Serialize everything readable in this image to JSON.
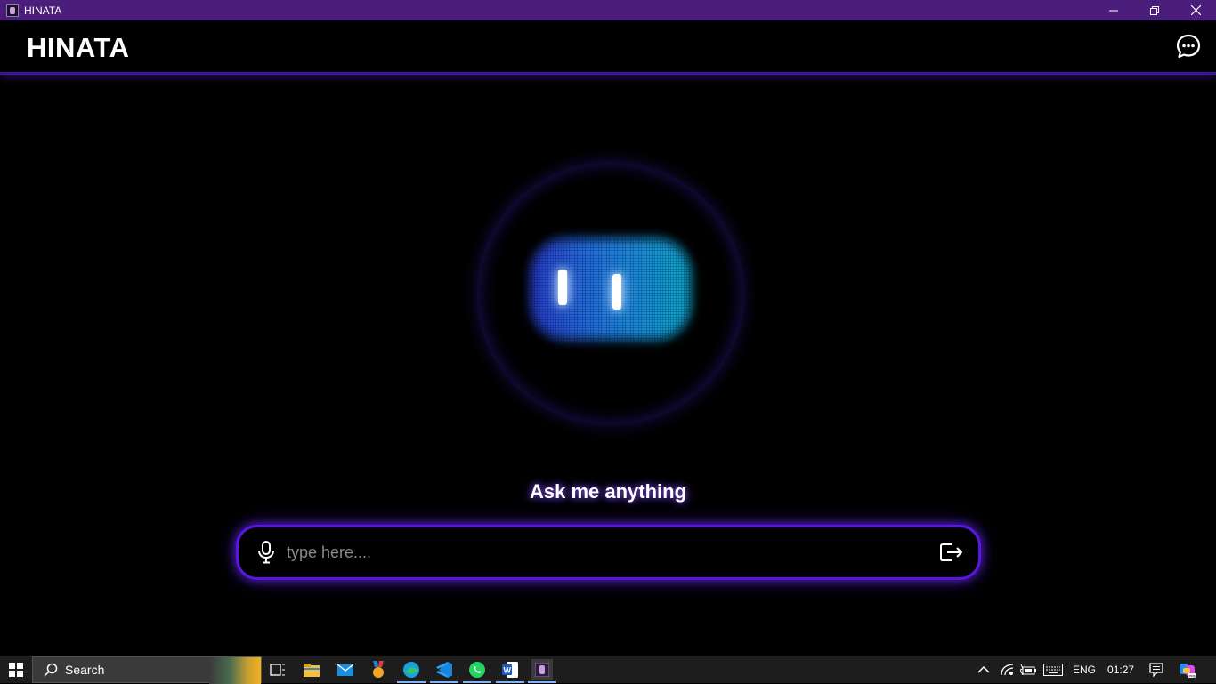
{
  "window": {
    "title": "HINATA",
    "controls": [
      "minimize",
      "restore",
      "close"
    ]
  },
  "header": {
    "brand": "HINATA",
    "chat_icon": "chat-bubble-icon"
  },
  "assistant": {
    "prompt": "Ask me anything",
    "input": {
      "value": "",
      "placeholder": "type here...."
    },
    "mic_icon": "microphone-icon",
    "send_icon": "exit-arrow-icon"
  },
  "taskbar": {
    "search_label": "Search",
    "apps": [
      "task-view",
      "file-explorer",
      "mail",
      "achievement",
      "edge",
      "vscode",
      "whatsapp",
      "word",
      "hinata"
    ],
    "tray": {
      "language": "ENG",
      "time": "01:27"
    }
  },
  "colors": {
    "accent": "#5a16e0",
    "titlebar": "#4a1e7a",
    "face_blue": "#1e7ae8",
    "face_cyan": "#10b0d8"
  }
}
